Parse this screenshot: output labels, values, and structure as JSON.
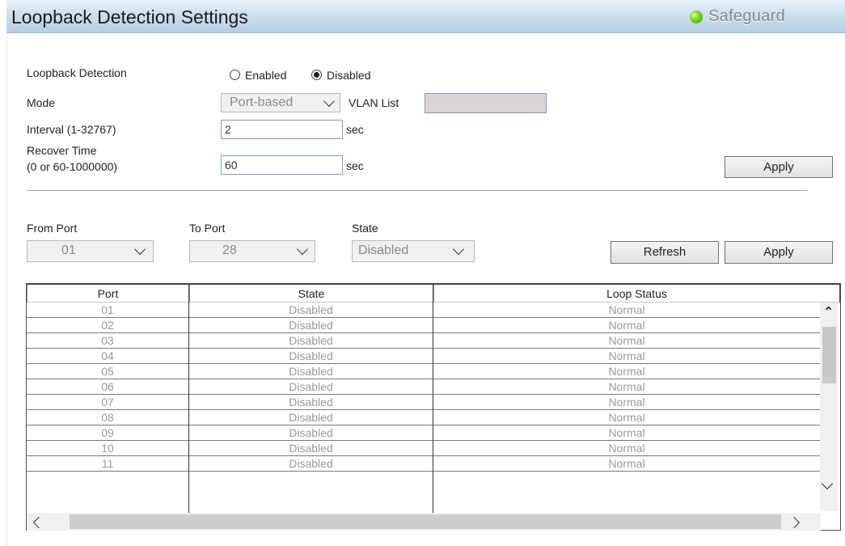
{
  "header": {
    "title": "Loopback Detection Settings",
    "safeguard_label": "Safeguard",
    "safeguard_color": "#6fd31e"
  },
  "settings": {
    "loopback_label": "Loopback Detection",
    "enabled_label": "Enabled",
    "disabled_label": "Disabled",
    "selected": "Disabled",
    "mode_label": "Mode",
    "mode_value": "Port-based",
    "vlan_list_label": "VLAN List",
    "vlan_list_value": "",
    "interval_label": "Interval (1-32767)",
    "interval_value": "2",
    "interval_unit": "sec",
    "recover_label_line1": "Recover Time",
    "recover_label_line2": "(0 or 60-1000000)",
    "recover_value": "60",
    "recover_unit": "sec",
    "apply_label": "Apply"
  },
  "port_config": {
    "from_port_label": "From Port",
    "from_port_value": "01",
    "to_port_label": "To Port",
    "to_port_value": "28",
    "state_label": "State",
    "state_value": "Disabled",
    "refresh_label": "Refresh",
    "apply_label": "Apply"
  },
  "table": {
    "columns": [
      "Port",
      "State",
      "Loop Status"
    ],
    "rows": [
      {
        "port": "01",
        "state": "Disabled",
        "status": "Normal"
      },
      {
        "port": "02",
        "state": "Disabled",
        "status": "Normal"
      },
      {
        "port": "03",
        "state": "Disabled",
        "status": "Normal"
      },
      {
        "port": "04",
        "state": "Disabled",
        "status": "Normal"
      },
      {
        "port": "05",
        "state": "Disabled",
        "status": "Normal"
      },
      {
        "port": "06",
        "state": "Disabled",
        "status": "Normal"
      },
      {
        "port": "07",
        "state": "Disabled",
        "status": "Normal"
      },
      {
        "port": "08",
        "state": "Disabled",
        "status": "Normal"
      },
      {
        "port": "09",
        "state": "Disabled",
        "status": "Normal"
      },
      {
        "port": "10",
        "state": "Disabled",
        "status": "Normal"
      },
      {
        "port": "11",
        "state": "Disabled",
        "status": "Normal"
      }
    ]
  }
}
